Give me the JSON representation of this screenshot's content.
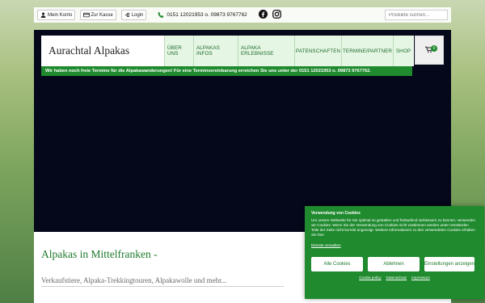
{
  "topbar": {
    "account_label": "Mein Konto",
    "checkout_label": "Zur Kasse",
    "login_label": "Login",
    "phone": "0151 12021953 o. 09873 9767762",
    "search_placeholder": "Produkte suchen…"
  },
  "header": {
    "brand": "Aurachtal Alpakas",
    "nav": [
      "ÜBER UNS",
      "ALPAKAS INFOS",
      "ALPAKA ERLEBNISSE",
      "PATENSCHAFTEN",
      "TERMINE/PARTNER",
      "SHOP"
    ],
    "cart_count": "0"
  },
  "notice": "Wir haben noch freie Termine für die Alpakawanderungen! Für eine Terminvereinbarung erreichen Sie uns unter der 0151 12021953 o. 09873 9767762.",
  "main": {
    "heading": "Alpakas in Mittelfranken -",
    "subtitle": "Verkaufstiere, Alpaka-Trekkingtouren, Alpakawolle und mehr..."
  },
  "cookie": {
    "title": "Verwendung von Cookies",
    "body": "Um unsere Webseite für Sie optimal zu gestalten und fortlaufend verbessern zu können, verwenden wir Cookies. Wenn Sie der Verwendung von Cookies nicht zustimmen werden unter Umständen Teile der Seite nicht korrekt angezeigt. Weitere Informationen zu den verwendeten Cookies erhalten Sie hier:",
    "manage_label": "Dienste verwalten",
    "accept_label": "Alle Cookies",
    "reject_label": "Ablehnen",
    "settings_label": "Einstellungen anzeigen",
    "links": [
      "Cookie policy",
      "Datenschutz",
      "Impressum"
    ]
  },
  "colors": {
    "brand_green": "#1f8a2e",
    "nav_bg": "#e6f6e4",
    "hero_bg": "#05071a"
  }
}
